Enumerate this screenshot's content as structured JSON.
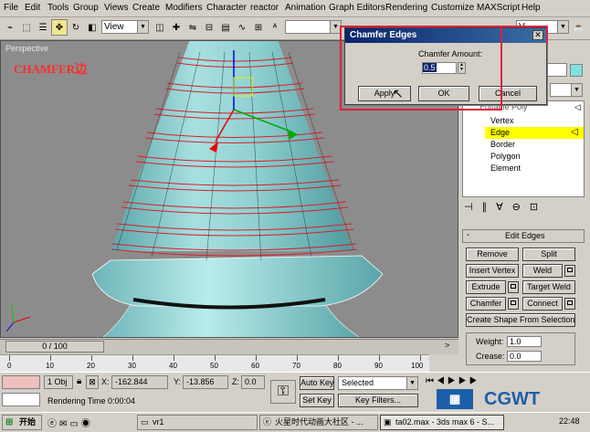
{
  "menubar": {
    "items": [
      "File",
      "Edit",
      "Tools",
      "Group",
      "Views",
      "Create",
      "Modifiers",
      "Character",
      "reactor",
      "Animation",
      "Graph Editors",
      "Rendering",
      "Customize",
      "MAXScript",
      "Help"
    ]
  },
  "toolbar": {
    "view_select": "View",
    "right_select": "V"
  },
  "viewport": {
    "label": "Perspective",
    "caption": "CHAMFER边"
  },
  "dialog": {
    "title": "Chamfer Edges",
    "amount_label": "Chamfer Amount:",
    "amount_value": "0.5",
    "apply_label": "Apply",
    "ok_label": "OK",
    "cancel_label": "Cancel"
  },
  "command_panel": {
    "stack_top": "Editable Poly",
    "sub_objects": [
      "Vertex",
      "Edge",
      "Border",
      "Polygon",
      "Element"
    ],
    "selected_sub_object": "Edge",
    "rollout_title": "Edit Edges",
    "buttons": {
      "remove": "Remove",
      "split": "Split",
      "insert_vertex": "Insert Vertex",
      "weld": "Weld",
      "extrude": "Extrude",
      "target_weld": "Target Weld",
      "chamfer": "Chamfer",
      "connect": "Connect",
      "create_shape": "Create Shape From Selection"
    },
    "weight_label": "Weight:",
    "weight_value": "1.0",
    "crease_label": "Crease:",
    "crease_value": "0.0"
  },
  "timeline": {
    "slider": "0 / 100",
    "ticks": [
      "0",
      "10",
      "20",
      "30",
      "40",
      "50",
      "60",
      "70",
      "80",
      "90",
      "100"
    ]
  },
  "status": {
    "selected_count": "1 Obj",
    "x_label": "X:",
    "x_value": "-162.844",
    "y_label": "Y:",
    "y_value": "-13.856",
    "z_label": "Z:",
    "z_value": "0.0",
    "auto_key": "Auto Key",
    "selected_dropdown": "Selected",
    "set_key": "Set Key",
    "key_filters": "Key Filters...",
    "rendering_time": "Rendering Time  0:00:04"
  },
  "taskbar": {
    "start": "开始",
    "tasks": [
      "vr1",
      "火星时代动画大社区 - ...",
      "ta02.max - 3ds max 6 - S..."
    ],
    "clock": "22:48"
  },
  "watermark": "CGWT",
  "colors": {
    "title_bar": "#0a246a",
    "highlight_yellow": "#ffff00",
    "annotation_red": "#e0203a",
    "mesh_teal": "#7fc7c7"
  }
}
